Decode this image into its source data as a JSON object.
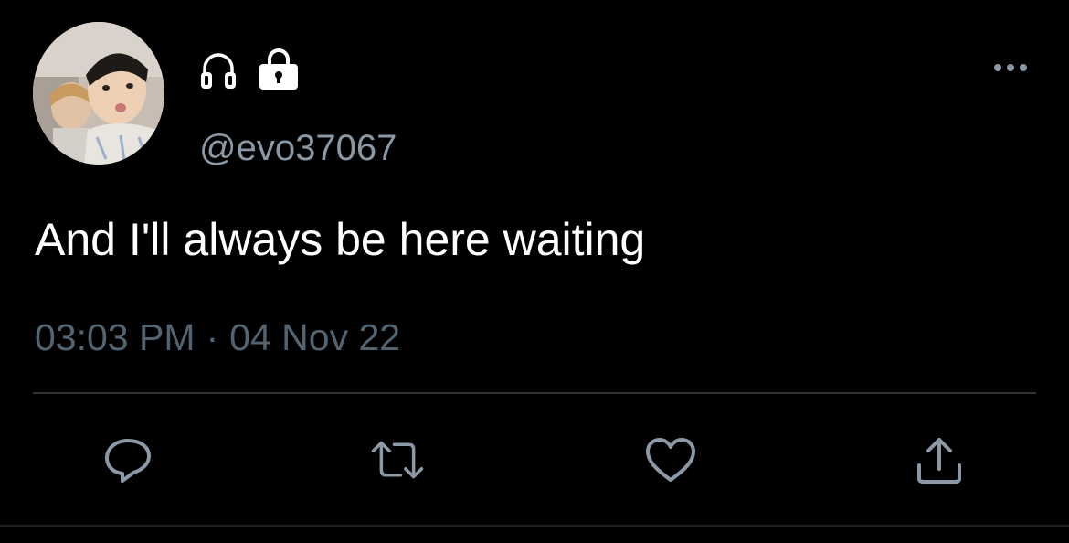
{
  "author": {
    "handle": "@evo37067",
    "name_icons": [
      "headphones-icon",
      "lock-icon"
    ]
  },
  "tweet": {
    "text": "And I'll always be here waiting",
    "time": "03:03 PM",
    "separator": "·",
    "date": "04 Nov 22"
  },
  "actions": [
    "reply-icon",
    "retweet-icon",
    "like-icon",
    "share-icon"
  ],
  "colors": {
    "background": "#000000",
    "text": "#ffffff",
    "secondary": "#8b98a5",
    "icon": "#8b98a5",
    "divider": "#2f3336"
  }
}
